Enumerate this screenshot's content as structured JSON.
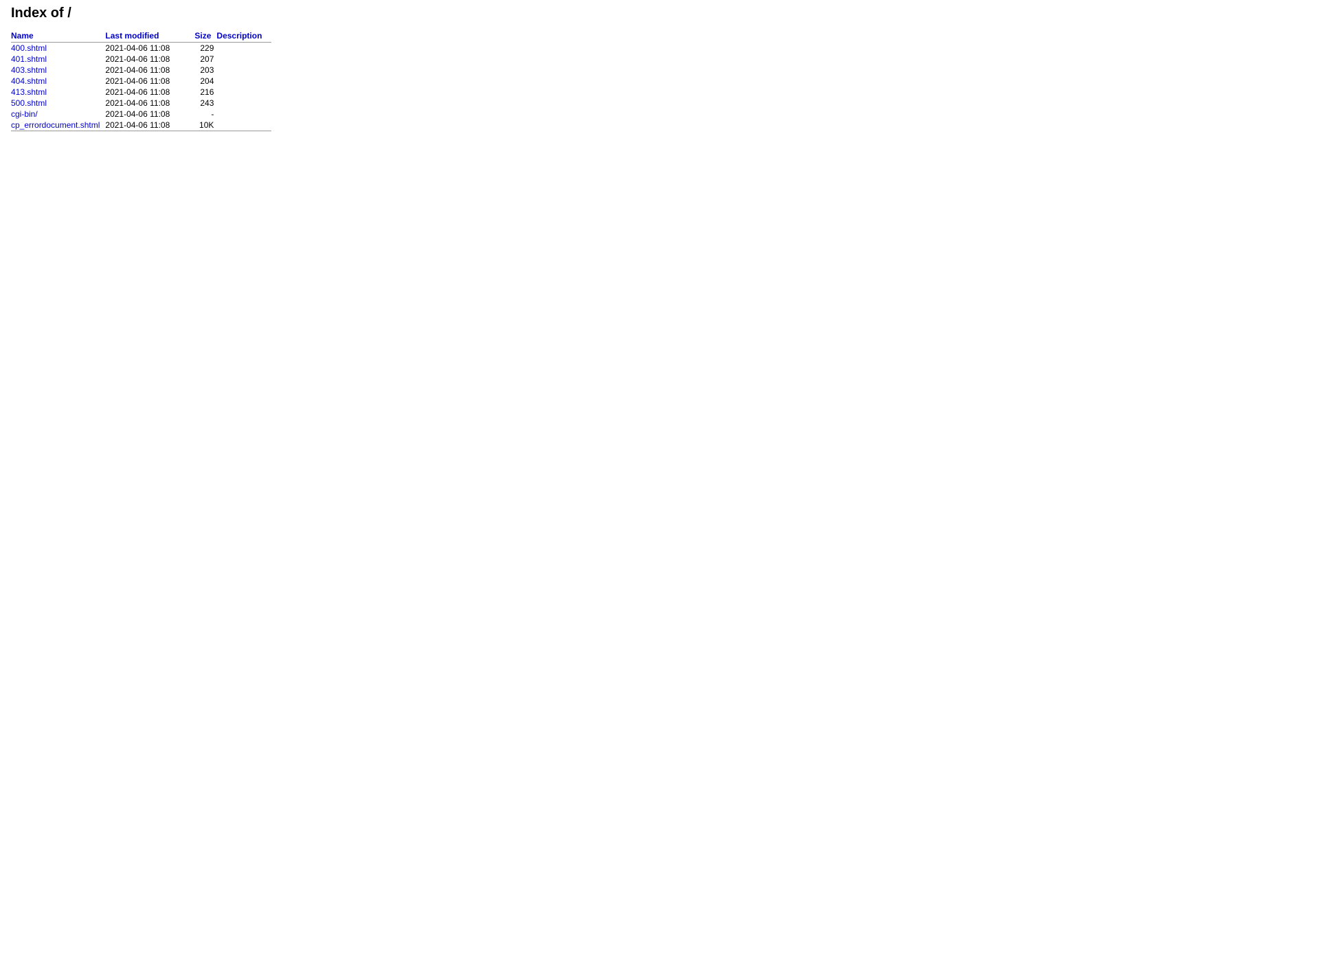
{
  "page": {
    "title": "Index of /",
    "h1": "Index of /"
  },
  "table": {
    "headers": {
      "name": "Name",
      "last_modified": "Last modified",
      "size": "Size",
      "description": "Description"
    },
    "rows": [
      {
        "name": "400.shtml",
        "href": "400.shtml",
        "modified": "2021-04-06 11:08",
        "size": "229",
        "description": ""
      },
      {
        "name": "401.shtml",
        "href": "401.shtml",
        "modified": "2021-04-06 11:08",
        "size": "207",
        "description": ""
      },
      {
        "name": "403.shtml",
        "href": "403.shtml",
        "modified": "2021-04-06 11:08",
        "size": "203",
        "description": ""
      },
      {
        "name": "404.shtml",
        "href": "404.shtml",
        "modified": "2021-04-06 11:08",
        "size": "204",
        "description": ""
      },
      {
        "name": "413.shtml",
        "href": "413.shtml",
        "modified": "2021-04-06 11:08",
        "size": "216",
        "description": ""
      },
      {
        "name": "500.shtml",
        "href": "500.shtml",
        "modified": "2021-04-06 11:08",
        "size": "243",
        "description": ""
      },
      {
        "name": "cgi-bin/",
        "href": "cgi-bin/",
        "modified": "2021-04-06 11:08",
        "size": "-",
        "description": ""
      },
      {
        "name": "cp_errordocument.shtml",
        "href": "cp_errordocument.shtml",
        "modified": "2021-04-06 11:08",
        "size": "10K",
        "description": ""
      }
    ]
  }
}
